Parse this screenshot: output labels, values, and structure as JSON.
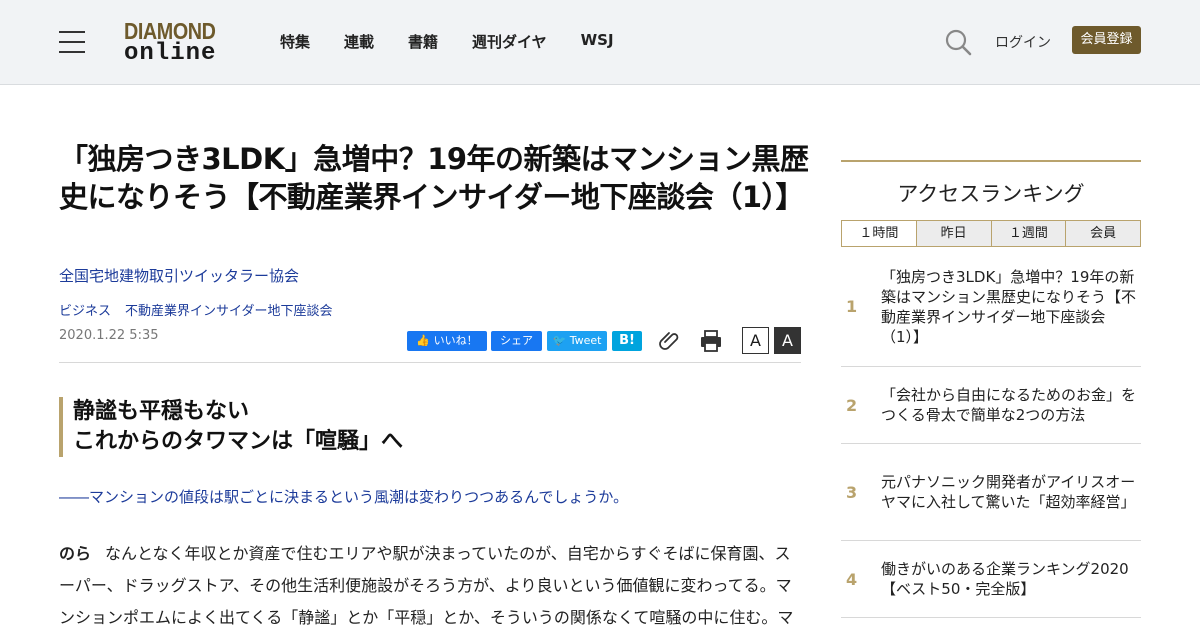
{
  "header": {
    "logo_line1": "DIAMOND",
    "logo_line2": "online",
    "nav": [
      "特集",
      "連載",
      "書籍",
      "週刊ダイヤ",
      "WSJ"
    ],
    "login": "ログイン",
    "register": "会員登録"
  },
  "article": {
    "title": "「独房つき3LDK」急増中？19年の新築はマンション黒歴史になりそう【不動産業界インサイダー地下座談会（1）】",
    "author": "全国宅地建物取引ツイッタラー協会",
    "category": "ビジネス",
    "series": "不動産業界インサイダー地下座談会",
    "date": "2020.1.22 5:35",
    "share": {
      "fb_like": "いいね！",
      "fb_share": "シェア",
      "tweet": "Tweet",
      "hatena": "B!"
    },
    "font_small": "A",
    "font_large": "A",
    "subhead_line1": "静謐も平穏もない",
    "subhead_line2": "これからのタワマンは「喧騒」へ",
    "lead": "――マンションの値段は駅ごとに決まるという風潮は変わりつつあるんでしょうか。",
    "speaker": "のら",
    "body": "なんとなく年収とか資産で住むエリアや駅が決まっていたのが、自宅からすぐそばに保育園、スーパー、ドラッグストア、その他生活利便施設がそろう方が、より良いという価値観に変わってる。マンションポエムによく出てくる「静謐」とか「平穏」とか、そういうの関係なくて喧騒の中に住む。マ"
  },
  "sidebar": {
    "title": "アクセスランキング",
    "tabs": [
      "１時間",
      "昨日",
      "１週間",
      "会員"
    ],
    "active_tab": "１時間",
    "items": [
      {
        "rank": "1",
        "text": "「独房つき3LDK」急増中？19年の新築はマンション黒歴史になりそう【不動産業界インサイダー地下座談会（1）】"
      },
      {
        "rank": "2",
        "text": "「会社から自由になるためのお金」をつくる骨太で簡単な2つの方法"
      },
      {
        "rank": "3",
        "text": "元パナソニック開発者がアイリスオーヤマに入社して驚いた「超効率経営」"
      },
      {
        "rank": "4",
        "text": "働きがいのある企業ランキング2020【ベスト50・完全版】"
      }
    ]
  },
  "colors": {
    "accent_gold": "#b9a36d",
    "brand_brown": "#6e5a2c",
    "link_blue": "#1c3b9a",
    "facebook": "#1877f2",
    "twitter": "#1da1f2",
    "hatena": "#00a4de"
  }
}
